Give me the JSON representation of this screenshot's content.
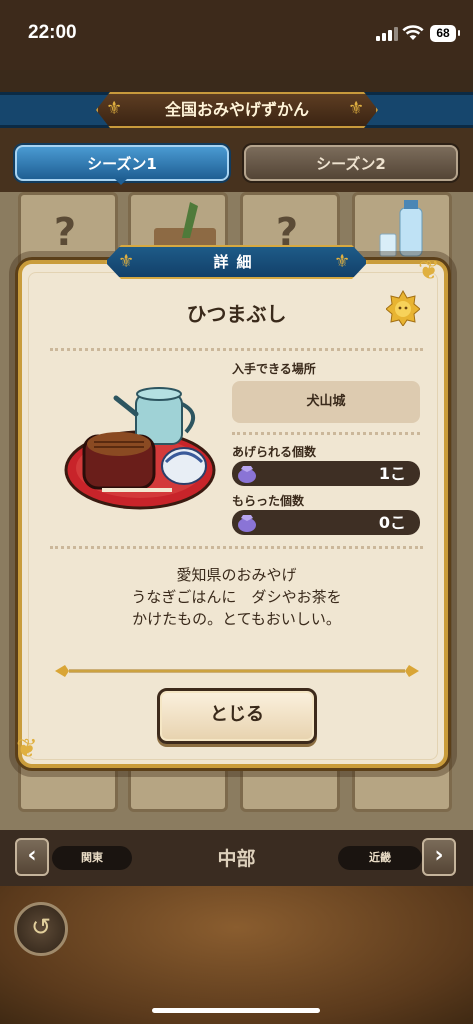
{
  "status_bar": {
    "time": "22:00",
    "battery": "68"
  },
  "header": {
    "title": "全国おみやげずかん"
  },
  "tabs": [
    {
      "label": "シーズン1",
      "active": true
    },
    {
      "label": "シーズン2",
      "active": false
    }
  ],
  "grid": {
    "placeholder": "?"
  },
  "modal": {
    "title": "詳細",
    "item_name": "ひつまぶし",
    "location_label": "入手できる場所",
    "location_value": "犬山城",
    "give_label": "あげられる個数",
    "give_value": "1こ",
    "received_label": "もらった個数",
    "received_value": "0こ",
    "description": [
      "愛知県のおみやげ",
      "うなぎごはんに　ダシやお茶を",
      "かけたもの。とてもおいしい。"
    ],
    "close_label": "とじる"
  },
  "nav": {
    "prev_region": "関東",
    "current_region": "中部",
    "next_region": "近畿",
    "prev_arrow": "‹",
    "next_arrow": "›"
  },
  "back": {
    "icon": "↺"
  },
  "colors": {
    "accent_blue": "#1f5f93",
    "gold": "#c99c3b",
    "panel": "#f0e6d2",
    "dark_brown": "#3a2a1b"
  }
}
